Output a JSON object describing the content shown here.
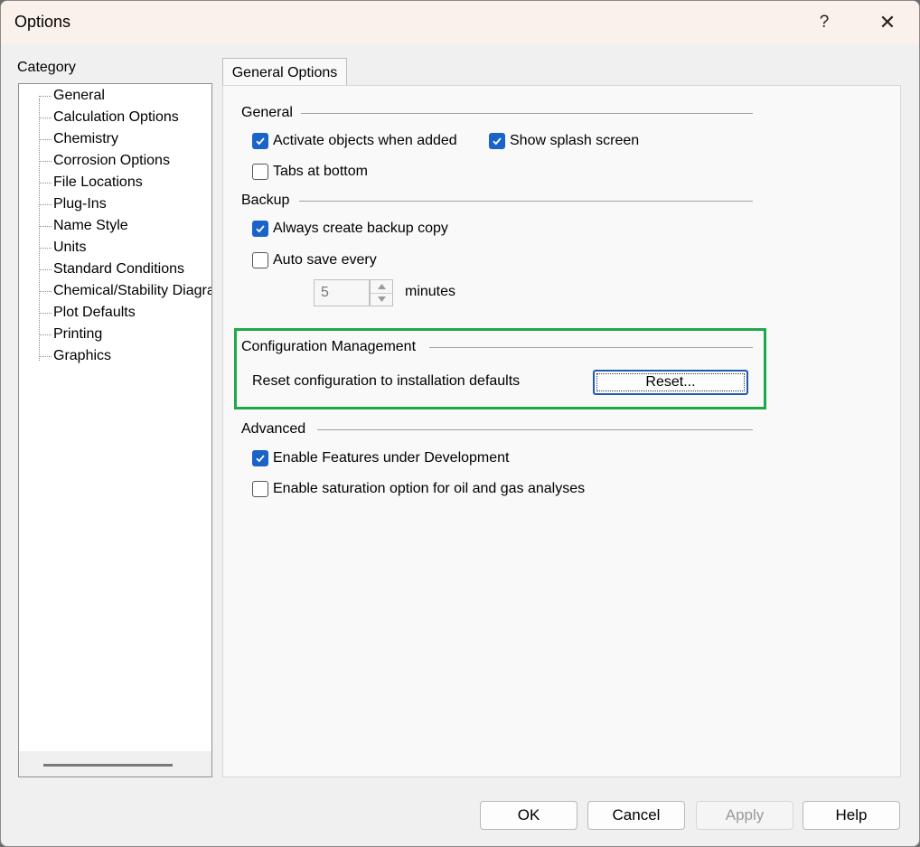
{
  "window": {
    "title": "Options",
    "help_glyph": "?",
    "close_glyph": "✕"
  },
  "category": {
    "label": "Category",
    "items": [
      "General",
      "Calculation Options",
      "Chemistry",
      "Corrosion Options",
      "File Locations",
      "Plug-Ins",
      "Name Style",
      "Units",
      "Standard Conditions",
      "Chemical/Stability Diagra",
      "Plot Defaults",
      "Printing",
      "Graphics"
    ],
    "selected": "General"
  },
  "tab": {
    "label": "General Options"
  },
  "general": {
    "title": "General",
    "activate_objects": {
      "label": "Activate objects when added",
      "checked": true
    },
    "show_splash": {
      "label": "Show splash screen",
      "checked": true
    },
    "tabs_bottom": {
      "label": "Tabs at bottom",
      "checked": false
    }
  },
  "backup": {
    "title": "Backup",
    "always_backup": {
      "label": "Always create backup copy",
      "checked": true
    },
    "auto_save": {
      "label": "Auto save every",
      "checked": false
    },
    "minutes_value": "5",
    "minutes_label": "minutes"
  },
  "config": {
    "title": "Configuration Management",
    "reset_text": "Reset configuration to installation defaults",
    "reset_button": "Reset..."
  },
  "advanced": {
    "title": "Advanced",
    "enable_features": {
      "label": "Enable Features under Development",
      "checked": true
    },
    "enable_saturation": {
      "label": "Enable saturation option for oil and gas analyses",
      "checked": false
    }
  },
  "buttons": {
    "ok": "OK",
    "cancel": "Cancel",
    "apply": "Apply",
    "help": "Help"
  },
  "colors": {
    "accent": "#1a63c8",
    "highlight": "#1fa84a"
  }
}
